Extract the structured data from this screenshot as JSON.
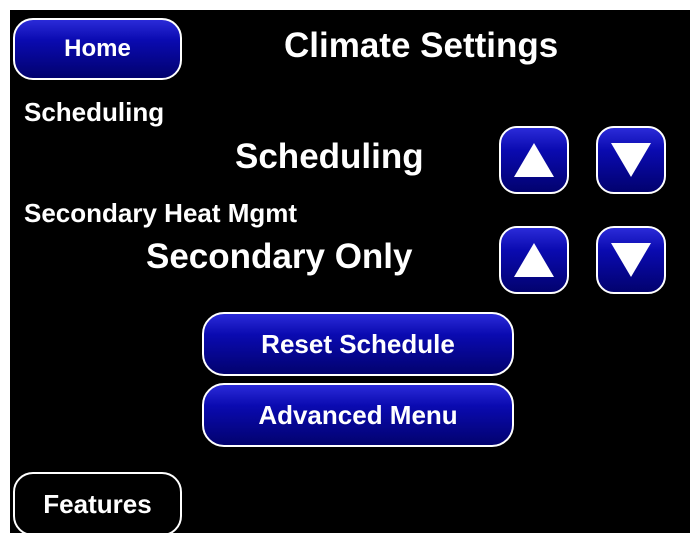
{
  "header": {
    "title": "Climate Settings",
    "home_label": "Home"
  },
  "scheduling": {
    "section_label": "Scheduling",
    "value": "Scheduling",
    "up_icon": "up-arrow-icon",
    "down_icon": "down-arrow-icon"
  },
  "secondary_heat": {
    "section_label": "Secondary Heat Mgmt",
    "value": "Secondary Only",
    "up_icon": "up-arrow-icon",
    "down_icon": "down-arrow-icon"
  },
  "actions": {
    "reset_schedule_label": "Reset Schedule",
    "advanced_menu_label": "Advanced Menu"
  },
  "footer": {
    "features_label": "Features"
  },
  "colors": {
    "background": "#000000",
    "button_blue": "#0a0ab0",
    "text": "#ffffff"
  }
}
